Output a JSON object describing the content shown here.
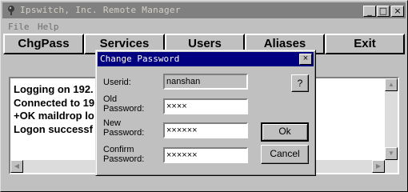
{
  "window": {
    "title": "Ipswitch, Inc. Remote Manager",
    "controls": {
      "minimize": "_",
      "maximize": "□",
      "close": "×"
    }
  },
  "menu": {
    "file": "File",
    "help": "Help"
  },
  "toolbar": {
    "buttons": [
      "ChgPass",
      "Services",
      "Users",
      "Aliases",
      "Exit"
    ]
  },
  "log": {
    "lines": [
      "Logging on 192.",
      "Connected to 19",
      "+OK maildrop lo",
      "Logon successf"
    ]
  },
  "dialog": {
    "title": "Change Password",
    "close": "×",
    "help_button": "?",
    "userid_label": "Userid:",
    "userid_value": "nanshan",
    "old_label_1": "Old",
    "old_label_2": "Password:",
    "old_value": "××××",
    "new_label_1": "New",
    "new_label_2": "Password:",
    "new_value": "××××××",
    "confirm_label_1": "Confirm",
    "confirm_label_2": "Password:",
    "confirm_value": "××××××",
    "ok_button": "Ok",
    "cancel_button": "Cancel"
  },
  "scrollbars": {
    "up": "▲",
    "down": "▼",
    "left": "◀",
    "right": "▶"
  }
}
